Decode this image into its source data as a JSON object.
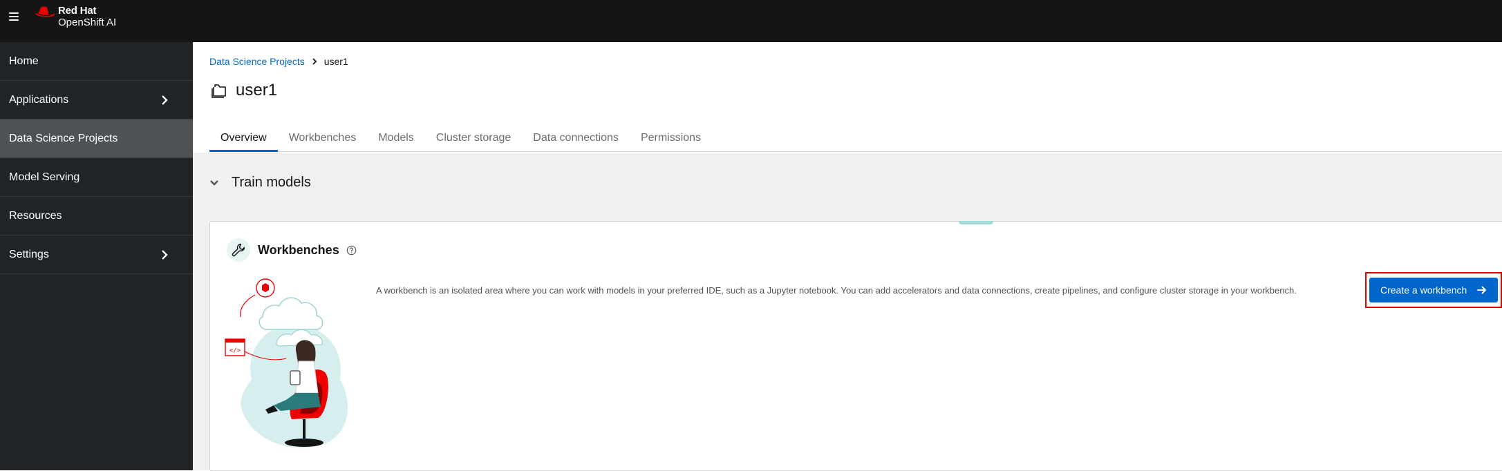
{
  "masthead": {
    "brand_line1": "Red Hat",
    "brand_line2": "OpenShift AI",
    "brand_color": "#ee0000"
  },
  "sidebar": {
    "items": [
      {
        "label": "Home",
        "has_children": false
      },
      {
        "label": "Applications",
        "has_children": true
      },
      {
        "label": "Data Science Projects",
        "has_children": false,
        "active": true
      },
      {
        "label": "Model Serving",
        "has_children": false
      },
      {
        "label": "Resources",
        "has_children": false
      },
      {
        "label": "Settings",
        "has_children": true
      }
    ]
  },
  "breadcrumb": {
    "parent": "Data Science Projects",
    "current": "user1"
  },
  "page": {
    "title": "user1",
    "icon": "project-folder-icon"
  },
  "tabs": [
    {
      "label": "Overview",
      "active": true
    },
    {
      "label": "Workbenches"
    },
    {
      "label": "Models"
    },
    {
      "label": "Cluster storage"
    },
    {
      "label": "Data connections"
    },
    {
      "label": "Permissions"
    }
  ],
  "section": {
    "title": "Train models",
    "expanded": true
  },
  "card": {
    "title": "Workbenches",
    "description": "A workbench is an isolated area where you can work with models in your preferred IDE, such as a Jupyter notebook. You can add accelerators and data connections, create pipelines, and configure cluster storage in your workbench.",
    "button_label": "Create a workbench"
  },
  "colors": {
    "accent": "#0066cc",
    "highlight": "#e00000",
    "masthead": "#151515",
    "sidebar": "#212427"
  }
}
